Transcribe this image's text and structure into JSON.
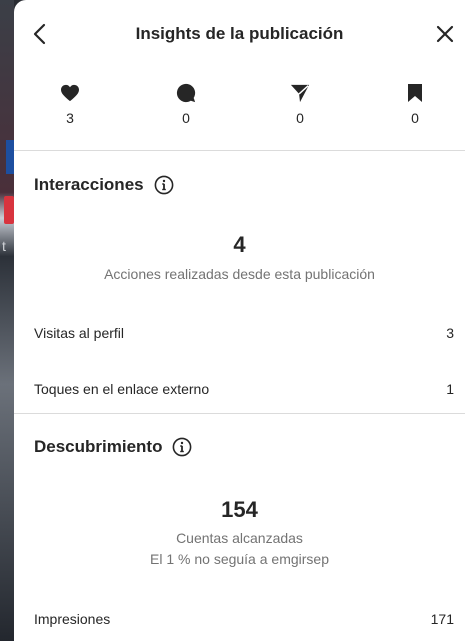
{
  "header": {
    "title": "Insights de la publicación",
    "back_icon": "chevron-left-icon",
    "close_icon": "close-icon"
  },
  "stats": [
    {
      "icon": "heart-icon",
      "value": "3"
    },
    {
      "icon": "comment-icon",
      "value": "0"
    },
    {
      "icon": "share-icon",
      "value": "0"
    },
    {
      "icon": "bookmark-icon",
      "value": "0"
    }
  ],
  "interactions": {
    "title": "Interacciones",
    "total": "4",
    "total_label": "Acciones realizadas desde esta publicación",
    "rows": [
      {
        "label": "Visitas al perfil",
        "value": "3"
      },
      {
        "label": "Toques en el enlace externo",
        "value": "1"
      }
    ]
  },
  "discovery": {
    "title": "Descubrimiento",
    "total": "154",
    "total_label": "Cuentas alcanzadas",
    "note": "El 1 % no seguía a emgirsep",
    "rows": [
      {
        "label": "Impresiones",
        "value": "171"
      }
    ]
  },
  "colors": {
    "text": "#262626",
    "secondary": "#737373",
    "divider": "#dbdbdb"
  }
}
